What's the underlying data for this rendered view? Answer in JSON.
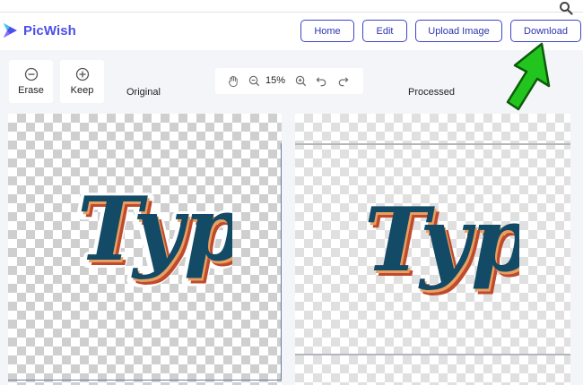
{
  "app": {
    "name": "PicWish"
  },
  "nav": {
    "home": "Home",
    "edit": "Edit",
    "upload": "Upload Image",
    "download": "Download"
  },
  "tools": {
    "erase": "Erase",
    "keep": "Keep"
  },
  "zoom": {
    "level": "15%"
  },
  "panes": {
    "original": "Original",
    "processed": "Processed"
  },
  "artwork": {
    "text": "Type"
  },
  "colors": {
    "brand": "#4a50e8",
    "button_border": "#3f46c4",
    "arrow": "#22c51e",
    "type_fill": "#134a66",
    "type_outline": "#e07a3c"
  }
}
